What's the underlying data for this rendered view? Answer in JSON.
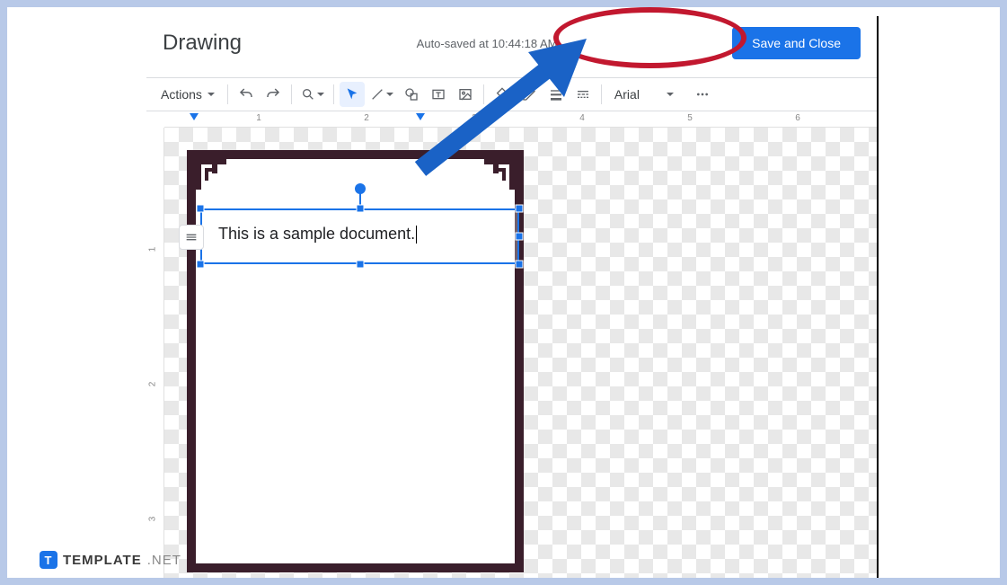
{
  "header": {
    "title": "Drawing",
    "autosave": "Auto-saved at 10:44:18 AM",
    "save_close": "Save and Close"
  },
  "toolbar": {
    "actions": "Actions",
    "font": "Arial"
  },
  "canvas": {
    "textbox": "This is a sample document."
  },
  "ruler": {
    "h": [
      "1",
      "2",
      "3",
      "4",
      "5",
      "6"
    ],
    "v": [
      "1",
      "2",
      "3"
    ]
  },
  "watermark": {
    "brand": "TEMPLATE",
    "suffix": ".NET",
    "icon": "T"
  }
}
